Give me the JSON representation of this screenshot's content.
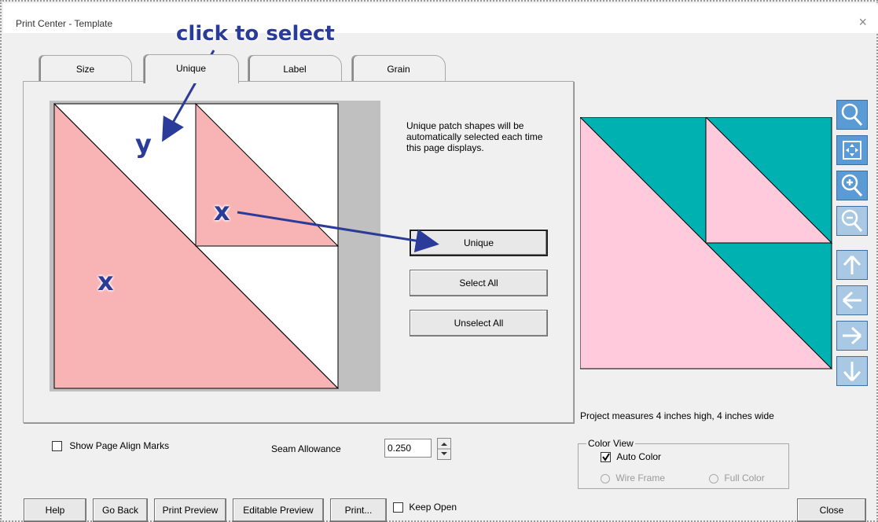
{
  "window": {
    "title": "Print Center - Template",
    "close_icon": "×"
  },
  "tabs": [
    {
      "label": "Size"
    },
    {
      "label": "Unique"
    },
    {
      "label": "Label"
    },
    {
      "label": "Grain"
    }
  ],
  "annotation": {
    "callout": "click to select",
    "y_label": "y",
    "x_small": "x",
    "x_large": "x"
  },
  "unique_panel": {
    "help_text": "Unique patch shapes will be automatically selected each time this page displays.",
    "unique_button": "Unique",
    "select_all_button": "Select All",
    "unselect_all_button": "Unselect All"
  },
  "preview": {
    "measure_text": "Project measures 4 inches high, 4 inches wide"
  },
  "colors": {
    "pink": "#ffcadb",
    "salmon": "#f8b4b4",
    "teal": "#00b1b1",
    "accent": "#5b9bd5",
    "arrow": "#2a3b9a"
  },
  "options": {
    "show_align_marks": "Show Page Align Marks",
    "seam_label": "Seam Allowance",
    "seam_value": "0.250",
    "color_view_legend": "Color View",
    "auto_color": "Auto Color",
    "wire_frame": "Wire Frame",
    "full_color": "Full Color",
    "keep_open": "Keep Open"
  },
  "buttons": {
    "help": "Help",
    "go_back": "Go Back",
    "print_preview": "Print Preview",
    "editable_preview": "Editable Preview",
    "print": "Print...",
    "close": "Close"
  }
}
